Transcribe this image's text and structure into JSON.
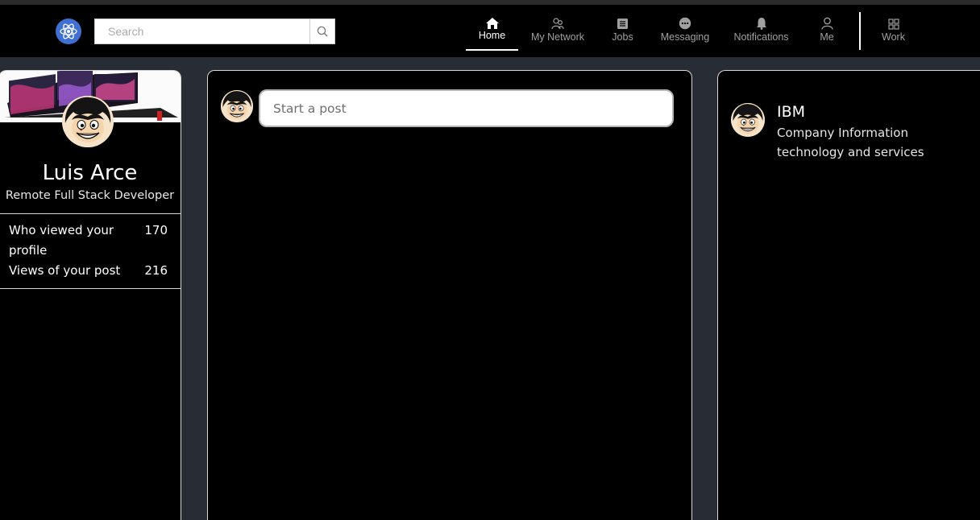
{
  "search": {
    "placeholder": "Search"
  },
  "nav": [
    {
      "label": "Home",
      "icon": "home-icon",
      "active": true
    },
    {
      "label": "My Network",
      "icon": "network-icon"
    },
    {
      "label": "Jobs",
      "icon": "jobs-icon"
    },
    {
      "label": "Messaging",
      "icon": "messaging-icon"
    },
    {
      "label": "Notifications",
      "icon": "bell-icon"
    },
    {
      "label": "Me",
      "icon": "user-icon"
    },
    {
      "label": "Work",
      "icon": "grid-icon"
    }
  ],
  "profile": {
    "name": "Luis Arce",
    "title": "Remote Full Stack Developer",
    "stats": [
      {
        "label": "Who viewed your profile",
        "value": "170"
      },
      {
        "label": "Views of your post",
        "value": "216"
      }
    ]
  },
  "feed": {
    "post_placeholder": "Start a post"
  },
  "company": {
    "name": "IBM",
    "description": "Company Information technology and services"
  },
  "colors": {
    "page_bg": "#282c34",
    "panel_bg": "#000000",
    "logo_blue": "#3f6fd1"
  }
}
